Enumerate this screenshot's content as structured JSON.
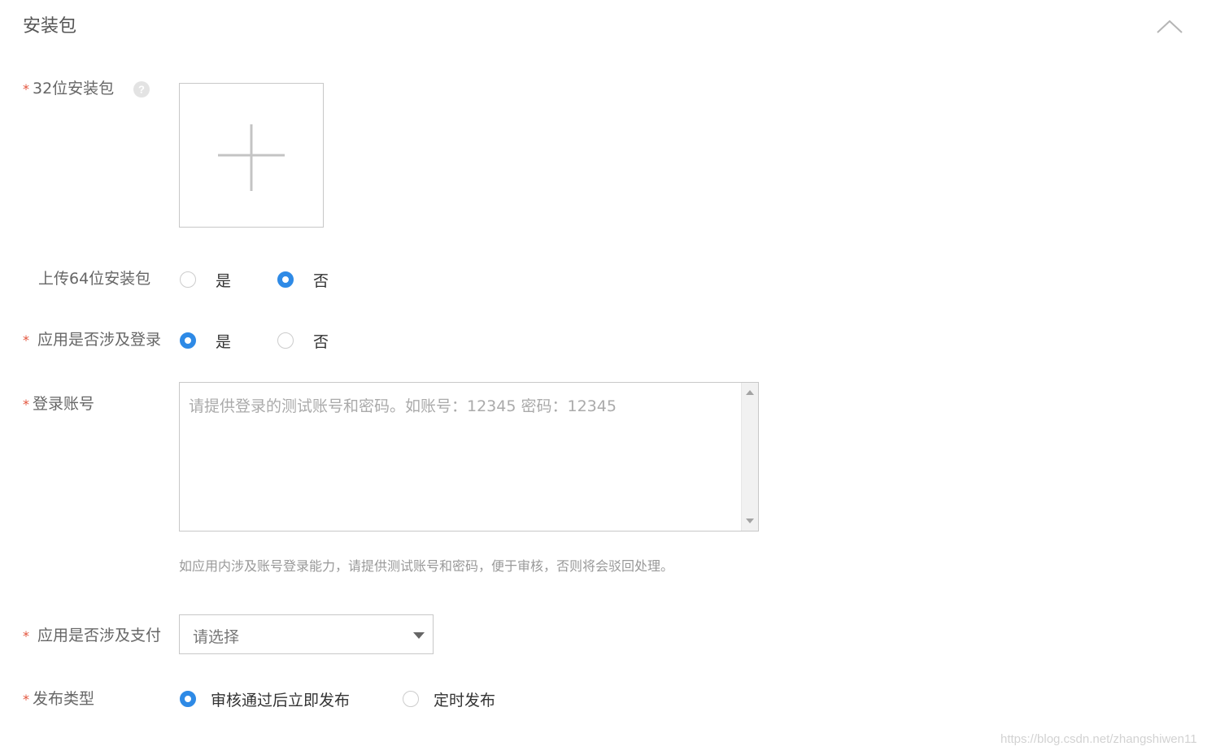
{
  "section": {
    "title": "安装包",
    "collapse_icon": "chevron-up-icon"
  },
  "package32": {
    "required_mark": "*",
    "label": "32位安装包",
    "help_icon": "question-circle-icon",
    "upload_icon": "plus-icon"
  },
  "upload64": {
    "label": "上传64位安装包",
    "options": [
      {
        "label": "是",
        "selected": false
      },
      {
        "label": "否",
        "selected": true
      }
    ]
  },
  "login_involved": {
    "required_mark": "*",
    "label": "应用是否涉及登录",
    "options": [
      {
        "label": "是",
        "selected": true
      },
      {
        "label": "否",
        "selected": false
      }
    ]
  },
  "login_account": {
    "required_mark": "*",
    "label": "登录账号",
    "value": "",
    "placeholder": "请提供登录的测试账号和密码。如账号：12345 密码：12345",
    "hint": "如应用内涉及账号登录能力，请提供测试账号和密码，便于审核，否则将会驳回处理。"
  },
  "payment_involved": {
    "required_mark": "*",
    "label": "应用是否涉及支付",
    "selected": "请选择"
  },
  "release_type": {
    "required_mark": "*",
    "label": "发布类型",
    "options": [
      {
        "label": "审核通过后立即发布",
        "selected": true
      },
      {
        "label": "定时发布",
        "selected": false
      }
    ]
  },
  "watermark": "https://blog.csdn.net/zhangshiwen11",
  "colors": {
    "accent": "#2e8ae6",
    "required": "#e4543c",
    "border": "#c8c8c8"
  }
}
